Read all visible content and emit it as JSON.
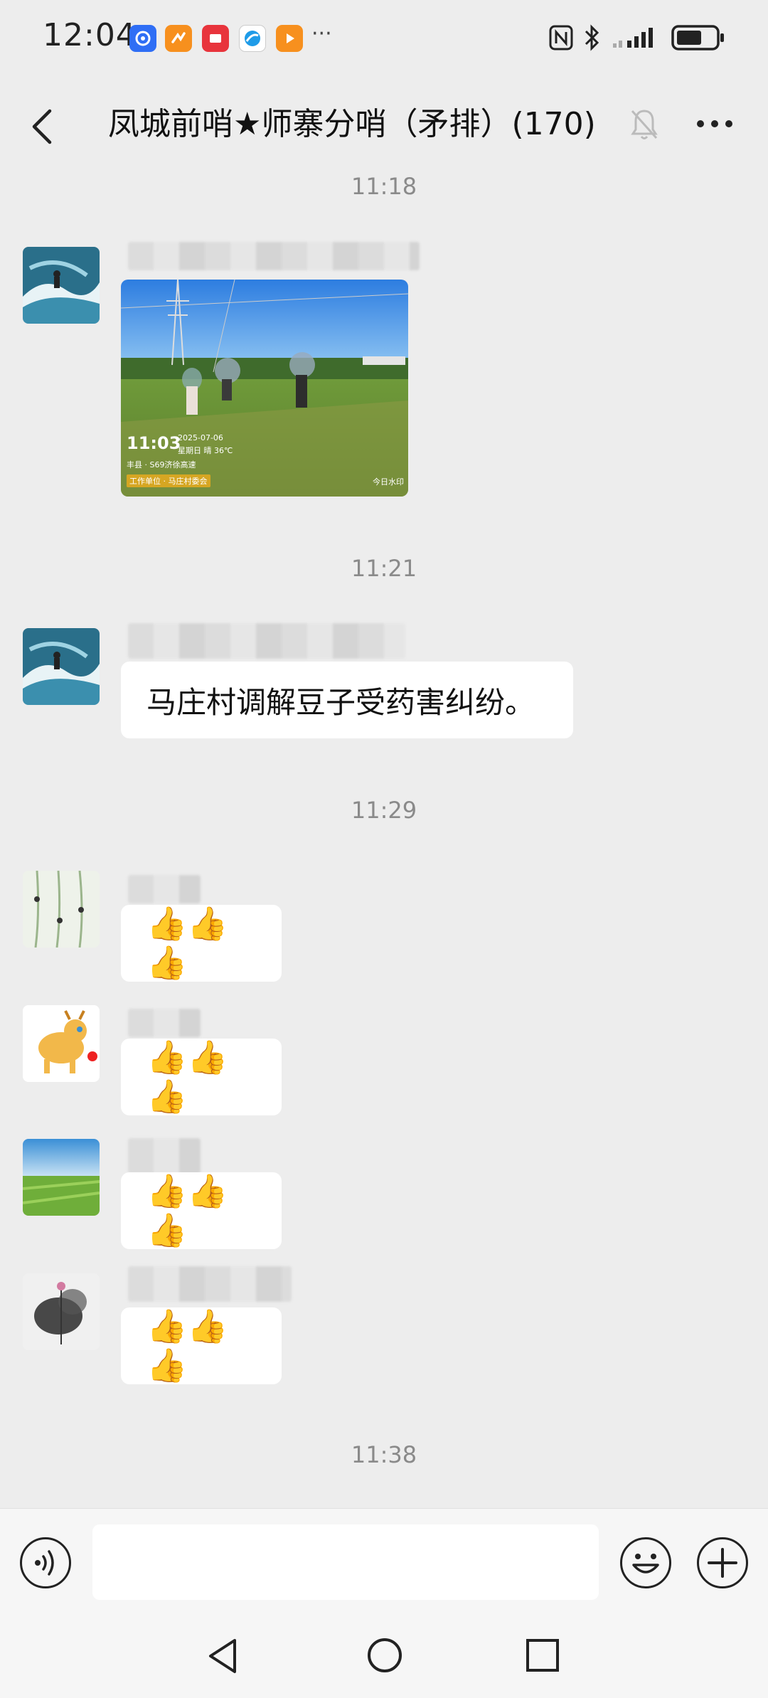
{
  "status_bar": {
    "time": "12:04",
    "overflow": "···",
    "icons": [
      "app-icon-blue",
      "app-icon-orange",
      "app-icon-red",
      "app-icon-browser",
      "app-icon-video",
      "nfc-icon",
      "bluetooth-icon",
      "signal-icon",
      "battery-icon"
    ]
  },
  "header": {
    "title": "凤城前哨★师寨分哨（矛排）(170)",
    "muted": true
  },
  "messages": {
    "time_1": "11:18",
    "image_msg": {
      "photo_time": "11:03",
      "photo_date": "2025-07-06",
      "photo_weekday": "星期日 晴 36℃",
      "photo_location": "丰县 · S69济徐高速",
      "photo_tag": "工作单位 · 马庄村委会",
      "watermark": "今日水印"
    },
    "time_2": "11:21",
    "text_msg": "马庄村调解豆子受药害纠纷。",
    "time_3": "11:29",
    "thumb_msgs": [
      "👍👍👍",
      "👍👍👍",
      "👍👍👍",
      "👍👍👍"
    ],
    "time_4": "11:38"
  },
  "input": {
    "placeholder": ""
  },
  "colors": {
    "background": "#ededed",
    "bubble": "#ffffff",
    "time_label": "#8a8a8a"
  }
}
